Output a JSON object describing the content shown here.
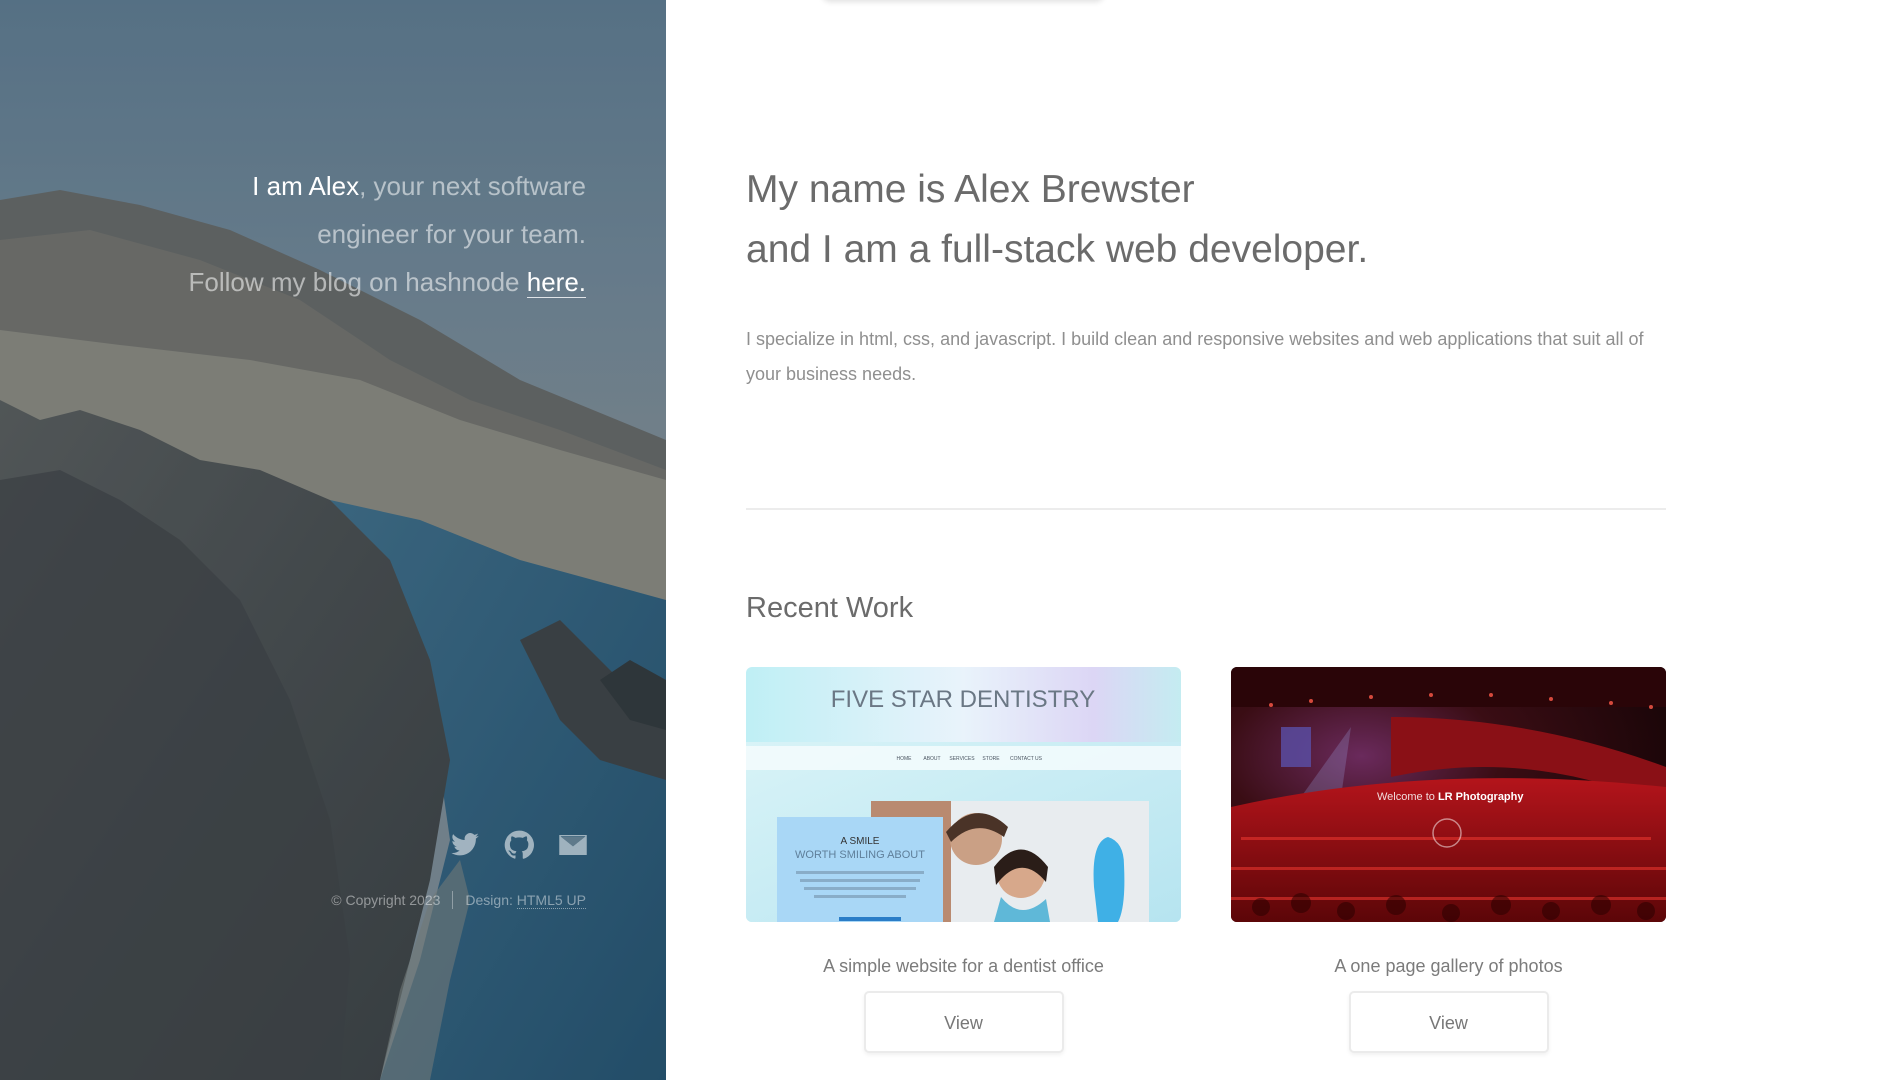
{
  "header": {
    "intro_name": "I am Alex",
    "intro_rest_1": ", your next software",
    "intro_line_2": "engineer for your team.",
    "intro_line_3": "Follow my blog on hashnode ",
    "intro_link": "here.",
    "social": [
      {
        "icon": "twitter-icon"
      },
      {
        "icon": "github-icon"
      },
      {
        "icon": "envelope-icon"
      }
    ],
    "copyright": "© Copyright 2023",
    "design_label": "Design: ",
    "design_link": "HTML5 UP"
  },
  "main": {
    "headline_line_1": "My name is Alex Brewster",
    "headline_line_2": "and I am a full-stack web developer.",
    "lead": "I specialize in html, css, and javascript. I build clean and responsive websites and web applications that suit all of your business needs.",
    "section_title": "Recent Work",
    "works": [
      {
        "thumb_title": "FIVE STAR DENTISTRY",
        "thumb_nav": [
          "HOME",
          "ABOUT",
          "SERVICES",
          "STORE",
          "CONTACT US"
        ],
        "thumb_card_title": "A SMILE",
        "thumb_card_subtitle": "WORTH SMILING ABOUT",
        "caption": "A simple website for a dentist office",
        "button": "View"
      },
      {
        "thumb_welcome": "Welcome to ",
        "thumb_brand": "LR Photography",
        "caption": "A one page gallery of photos",
        "button": "View"
      }
    ]
  },
  "colors": {
    "header_bg": "#50646f",
    "text_main": "#6b6b6b",
    "text_muted": "#8f8f8f",
    "divider": "#ececec",
    "concert_red": "#c01818"
  }
}
